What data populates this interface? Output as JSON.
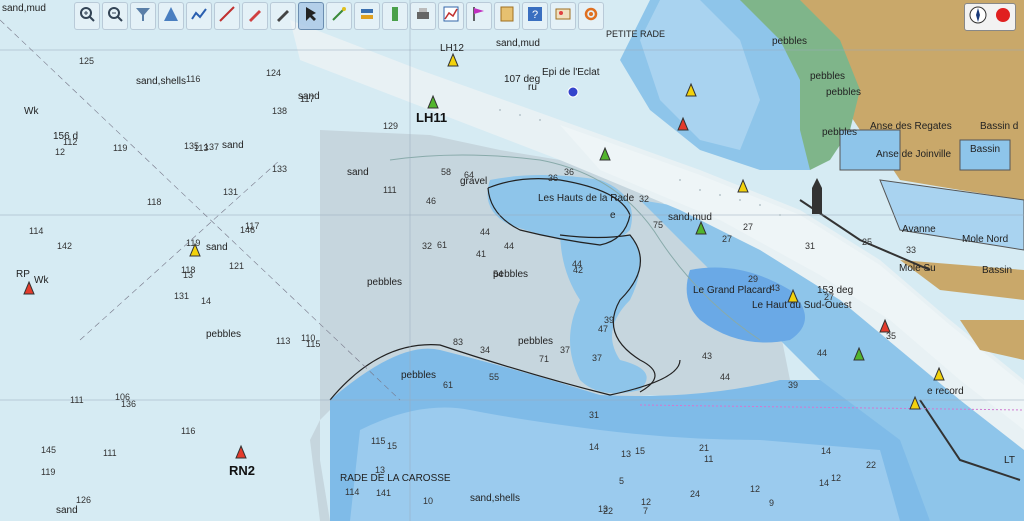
{
  "map": {
    "labels": {
      "sand_mud_tl": "sand,mud",
      "sand_shells_top": "sand,shells",
      "sand_1": "sand",
      "sand_2": "sand",
      "sand_3": "sand",
      "sand_4": "sand",
      "sand_bottom": "sand",
      "gravel": "gravel",
      "pebbles_1": "pebbles",
      "pebbles_2": "pebbles",
      "pebbles_3": "pebbles",
      "pebbles_4": "pebbles",
      "pebbles_5": "pebbles",
      "pebbles_6": "pebbles",
      "pebbles_7": "pebbles",
      "pebbles_8": "pebbles",
      "pebbles_9": "pebbles",
      "sand_mud_top": "sand,mud",
      "sand_mud_channel": "sand,mud",
      "sand_shells_bottom": "sand,shells",
      "petite_rade": "PETITE RADE",
      "les_hauts_de_la_rade": "Les Hauts de la Rade",
      "le_grand_placard": "Le Grand Placard",
      "le_haut_du_sud_ouest": "Le Haut du Sud-Ouest",
      "rade_de_la_carosse": "RADE DE LA CAROSSE",
      "anse_des_regates": "Anse des Regates",
      "anse_de_joinville": "Anse de Joinville",
      "bassin_d": "Bassin d",
      "bassin_2": "Bassin",
      "bassin_3": "Bassin",
      "avanne": "Avanne",
      "mole_nord": "Mole Nord",
      "mole_su": "Mole Su",
      "epi_de_l_eclat": "Epi de l'Eclat",
      "bearing_107": "107 deg",
      "bearing_156": "156 d",
      "bearing_153": "153 deg",
      "lh12": "LH12",
      "lh11": "LH11",
      "rn2": "RN2",
      "wk_1": "Wk",
      "wk_2": "Wk",
      "rp": "RP",
      "lt": "LT",
      "e_record": "e record",
      "fragment_ru": "ru",
      "fragment_e": "e"
    },
    "soundings": {
      "open_water": [
        "14",
        "12",
        "13",
        "145",
        "146",
        "136",
        "124",
        "137",
        "138",
        "121",
        "125",
        "141",
        "142",
        "129",
        "131",
        "133",
        "126",
        "135",
        "131",
        "111",
        "118",
        "119",
        "111",
        "113",
        "117",
        "115",
        "112",
        "116",
        "114",
        "113",
        "111",
        "118",
        "116",
        "119",
        "119",
        "117",
        "106",
        "114",
        "115",
        "110"
      ],
      "inner_bay": [
        "36",
        "44",
        "41",
        "47",
        "55",
        "32",
        "44",
        "61",
        "71",
        "42",
        "83",
        "75",
        "46",
        "39",
        "37",
        "34",
        "64",
        "58",
        "37",
        "32",
        "36",
        "54",
        "61",
        "44"
      ],
      "channel": [
        "33",
        "27",
        "25",
        "31",
        "27",
        "43",
        "44",
        "39",
        "35",
        "43",
        "44",
        "27",
        "29"
      ],
      "south_deep": [
        "13",
        "14",
        "12",
        "15",
        "10",
        "11",
        "12",
        "13",
        "14",
        "5",
        "9",
        "7",
        "24",
        "31",
        "22",
        "21",
        "12",
        "13",
        "14",
        "15",
        "22"
      ]
    }
  },
  "toolbar": {
    "tools": [
      {
        "icon": "zoom-in-icon"
      },
      {
        "icon": "zoom-out-icon"
      },
      {
        "icon": "filter-icon"
      },
      {
        "icon": "triangle-icon"
      },
      {
        "icon": "route-icon"
      },
      {
        "icon": "measure-icon"
      },
      {
        "icon": "pencil-icon"
      },
      {
        "icon": "pen-icon"
      },
      {
        "icon": "cursor-icon",
        "active": true
      },
      {
        "icon": "draw-icon"
      },
      {
        "icon": "layers-icon"
      },
      {
        "icon": "tide-icon"
      },
      {
        "icon": "print-icon"
      },
      {
        "icon": "graph-icon"
      },
      {
        "icon": "flag-icon"
      },
      {
        "icon": "notes-icon"
      },
      {
        "icon": "help-icon"
      },
      {
        "icon": "image-icon"
      },
      {
        "icon": "settings-icon"
      }
    ]
  },
  "compass": {
    "north_icon": "compass-icon",
    "record_icon": "record-icon"
  },
  "colors": {
    "water_light": "#d6ebf3",
    "water_mid": "#bcdbed",
    "water_deep": "#8ec5ea",
    "shoal": "#6aa9e6",
    "land": "#c9a86a",
    "green_shore": "#7fb58a",
    "channel": "#e8f1f4"
  }
}
